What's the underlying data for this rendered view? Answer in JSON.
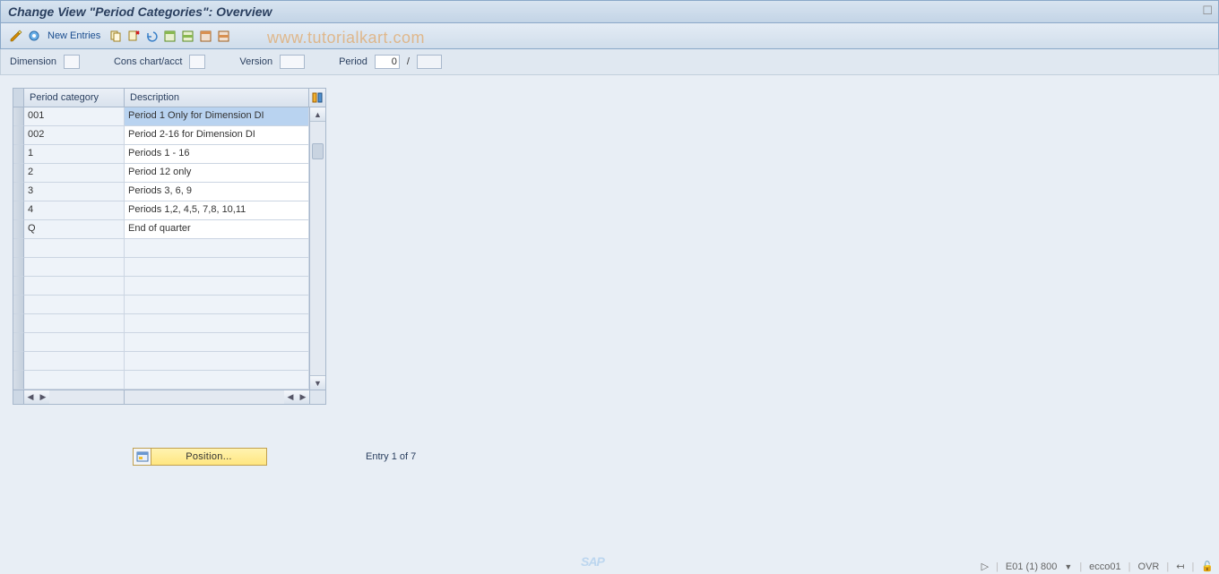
{
  "title": "Change View \"Period Categories\": Overview",
  "toolbar": {
    "new_entries_label": "New Entries"
  },
  "watermark": "www.tutorialkart.com",
  "filters": {
    "dimension_label": "Dimension",
    "dimension_value": "",
    "cons_label": "Cons chart/acct",
    "cons_value": "",
    "version_label": "Version",
    "version_value": "",
    "period_label": "Period",
    "period_value": "0",
    "period_sep": "/",
    "period_year": ""
  },
  "columns": {
    "period_category": "Period category",
    "description": "Description"
  },
  "rows": [
    {
      "pc": "001",
      "desc": "Period 1 Only for Dimension DI",
      "highlight": true
    },
    {
      "pc": "002",
      "desc": "Period 2-16 for Dimension DI"
    },
    {
      "pc": "1",
      "desc": "Periods 1 - 16"
    },
    {
      "pc": "2",
      "desc": "Period 12 only"
    },
    {
      "pc": "3",
      "desc": "Periods 3, 6, 9"
    },
    {
      "pc": "4",
      "desc": "Periods 1,2, 4,5, 7,8, 10,11"
    },
    {
      "pc": "Q",
      "desc": "End of quarter"
    }
  ],
  "empty_rows": 8,
  "position_button": "Position...",
  "entry_text": "Entry 1 of 7",
  "status": {
    "system": "E01 (1) 800",
    "server": "ecco01",
    "mode": "OVR"
  }
}
